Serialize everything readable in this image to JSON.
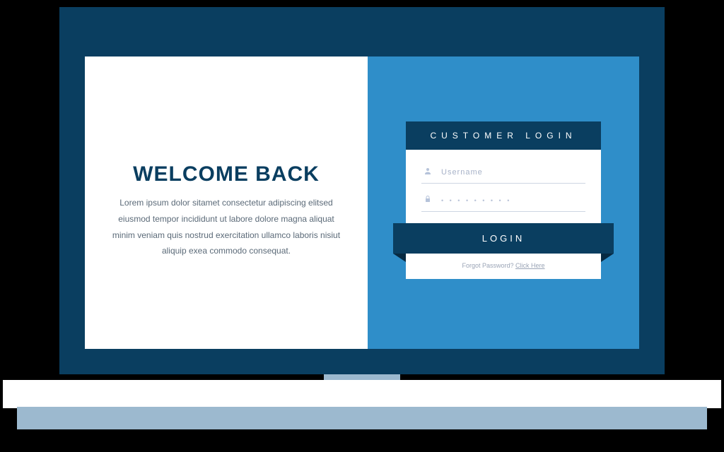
{
  "welcome": {
    "title": "WELCOME BACK",
    "text": "Lorem ipsum dolor sitamet consectetur adipiscing elitsed eiusmod tempor incididunt ut labore dolore magna aliquat minim veniam quis nostrud exercitation ullamco laboris nisiut aliquip exea commodo consequat."
  },
  "login": {
    "header": "CUSTOMER LOGIN",
    "username_placeholder": "Username",
    "password_mask": "• • • • • • • • •",
    "button": "LOGIN",
    "forgot_prefix": "Forgot Password? ",
    "forgot_link": "Click Here"
  }
}
